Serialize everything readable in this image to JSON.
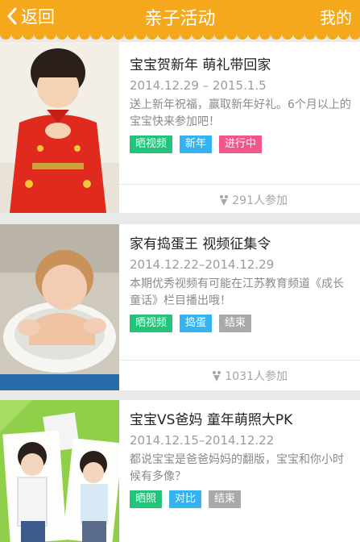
{
  "header": {
    "back_label": "返回",
    "title": "亲子活动",
    "mine_label": "我的",
    "bg_color": "#f5a81c"
  },
  "activities": [
    {
      "title": "宝宝贺新年 萌礼带回家",
      "date": "2014.12.29 – 2015.1.5",
      "desc": "送上新年祝福，赢取新年好礼。6个月以上的宝宝快来参加吧！",
      "tags": [
        "晒视频",
        "新年",
        "进行中"
      ],
      "participants": "291人参加",
      "icon": "people-icon"
    },
    {
      "title": "家有捣蛋王 视频征集令",
      "date": "2014.12.22–2014.12.29",
      "desc": "本期优秀视频有可能在江苏教育频道《成长童话》栏目播出哦！",
      "tags": [
        "晒视频",
        "捣蛋",
        "结束"
      ],
      "participants": "1031人参加",
      "icon": "people-icon"
    },
    {
      "title": "宝宝VS爸妈 童年萌照大PK",
      "date": "2014.12.15–2014.12.22",
      "desc": "都说宝宝是爸爸妈妈的翻版，宝宝和你小时候有多像？",
      "tags": [
        "晒照",
        "对比",
        "结束"
      ]
    }
  ]
}
